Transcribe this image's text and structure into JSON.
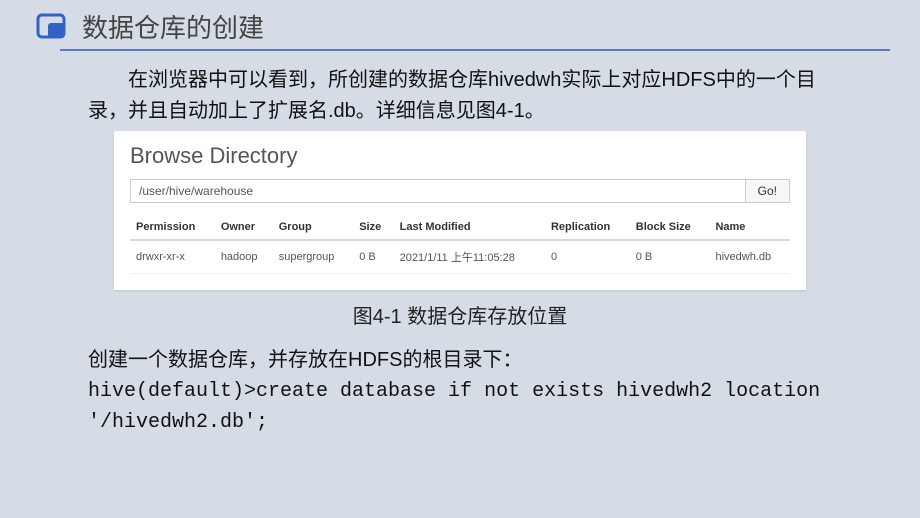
{
  "title": "数据仓库的创建",
  "paragraph1": "在浏览器中可以看到，所创建的数据仓库hivedwh实际上对应HDFS中的一个目录，并且自动加上了扩展名.db。详细信息见图4-1。",
  "figure": {
    "heading": "Browse Directory",
    "path_value": "/user/hive/warehouse",
    "go_label": "Go!",
    "columns": {
      "permission": "Permission",
      "owner": "Owner",
      "group": "Group",
      "size": "Size",
      "last_modified": "Last Modified",
      "replication": "Replication",
      "block_size": "Block Size",
      "name": "Name"
    },
    "row": {
      "permission": "drwxr-xr-x",
      "owner": "hadoop",
      "group": "supergroup",
      "size": "0 B",
      "last_modified": "2021/1/11 上午11:05:28",
      "replication": "0",
      "block_size": "0 B",
      "name": "hivedwh.db"
    }
  },
  "caption": "图4-1  数据仓库存放位置",
  "paragraph2_line1": "创建一个数据仓库，并存放在HDFS的根目录下：",
  "paragraph2_line2": "hive(default)>create database if not exists hivedwh2 location '/hivedwh2.db';"
}
